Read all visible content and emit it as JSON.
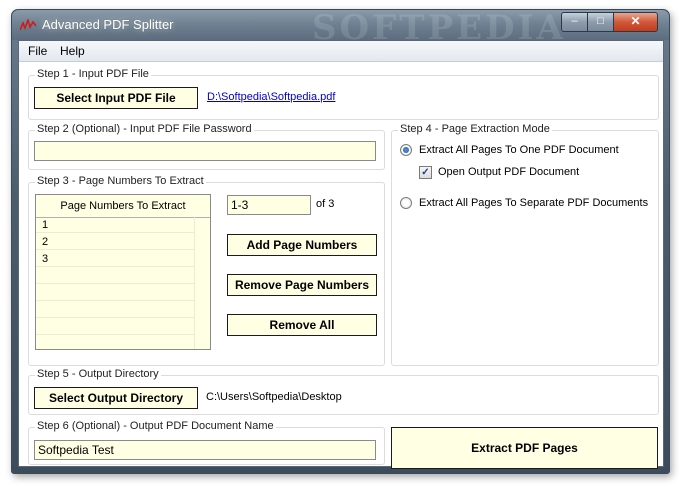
{
  "window": {
    "title": "Advanced PDF Splitter",
    "watermark": "SOFTPEDIA",
    "controls": {
      "minimize": "‒",
      "maximize": "□",
      "close": "✕"
    }
  },
  "menu": {
    "file": "File",
    "help": "Help"
  },
  "step1": {
    "label": "Step 1 - Input PDF File",
    "button": "Select Input PDF File",
    "path": "D:\\Softpedia\\Softpedia.pdf"
  },
  "step2": {
    "label": "Step 2 (Optional) - Input PDF File Password",
    "value": ""
  },
  "step3": {
    "label": "Step 3 - Page Numbers To Extract",
    "list_header": "Page Numbers To Extract",
    "rows": [
      "1",
      "2",
      "3"
    ],
    "range_value": "1-3",
    "of_text": "of 3",
    "add_button": "Add Page Numbers",
    "remove_button": "Remove Page Numbers",
    "remove_all_button": "Remove All"
  },
  "step4": {
    "label": "Step 4 - Page Extraction Mode",
    "option_one": "Extract All Pages To One PDF Document",
    "open_output": "Open Output PDF Document",
    "option_separate": "Extract All Pages To Separate PDF Documents",
    "option_one_selected": true,
    "open_output_checked": true
  },
  "step5": {
    "label": "Step 5 - Output Directory",
    "button": "Select Output Directory",
    "path": "C:\\Users\\Softpedia\\Desktop"
  },
  "step6": {
    "label": "Step 6 (Optional) - Output PDF Document Name",
    "value": "Softpedia Test"
  },
  "extract_button": "Extract PDF Pages",
  "colors": {
    "field_bg": "#ffffe3",
    "link": "#0000cc",
    "close": "#c43b1d"
  }
}
